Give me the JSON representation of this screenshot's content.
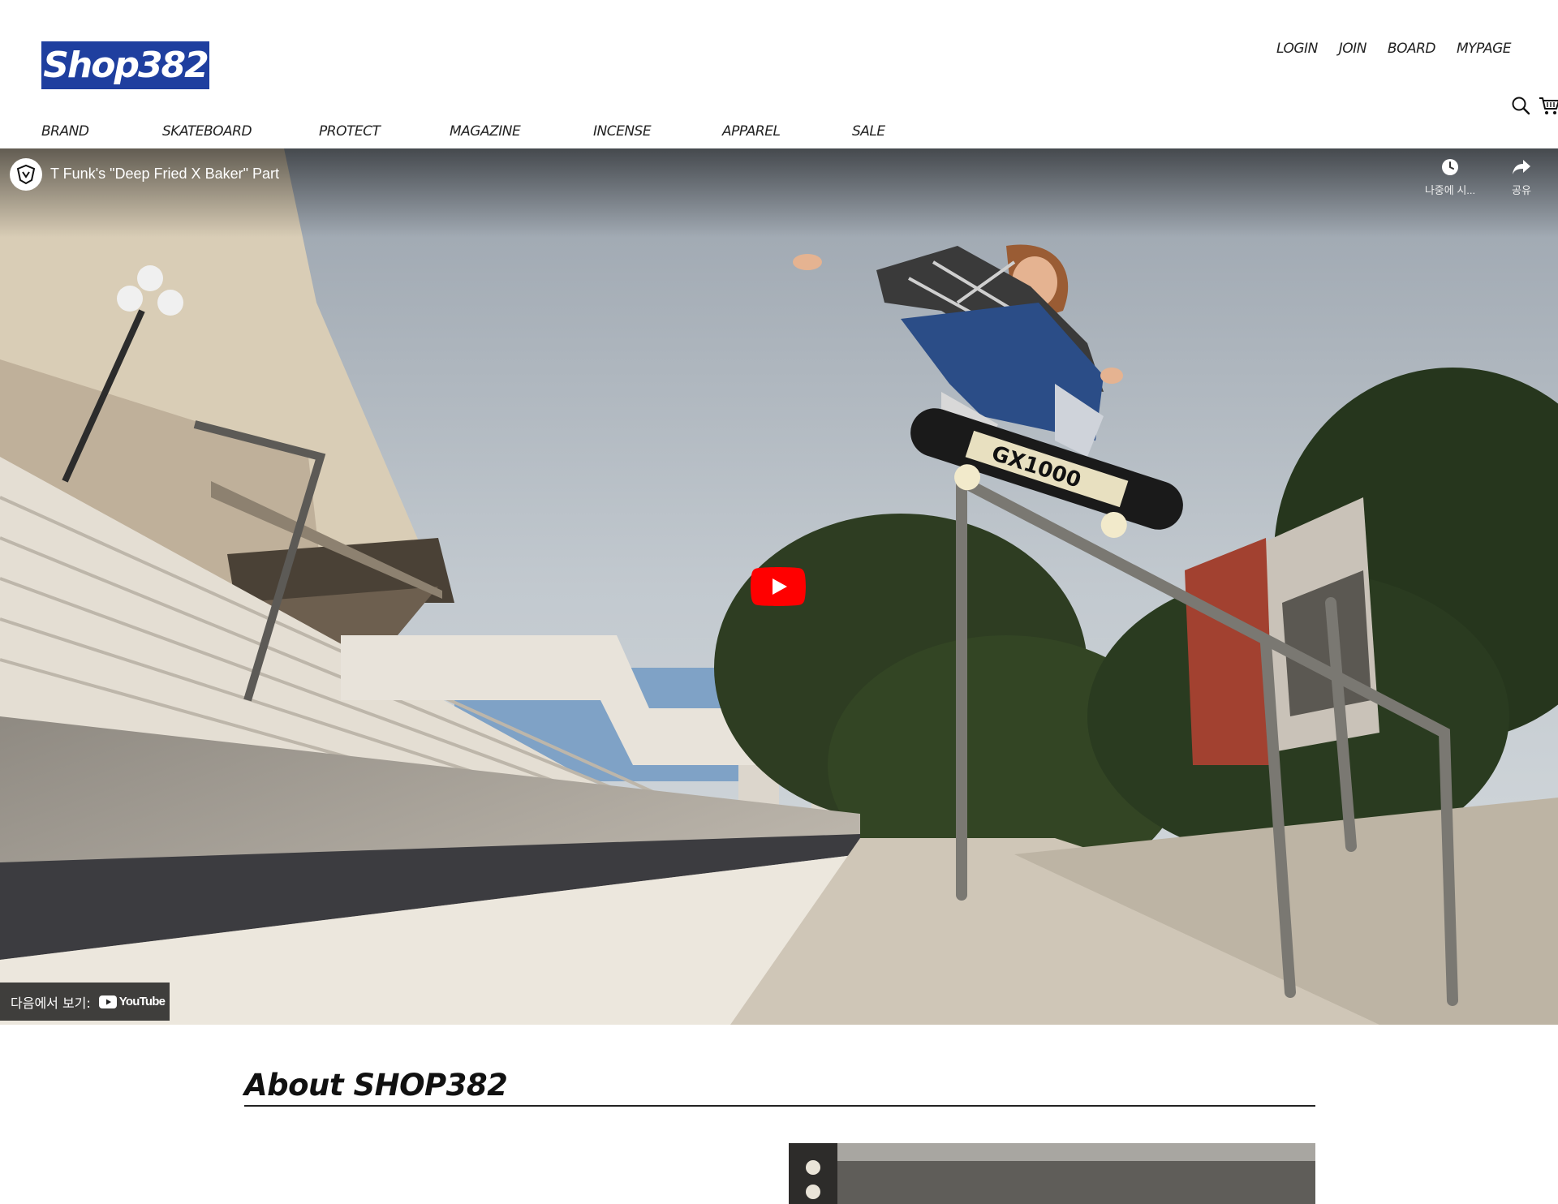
{
  "header": {
    "logo_text": "Shop382",
    "util_nav": [
      "LOGIN",
      "JOIN",
      "BOARD",
      "MYPAGE"
    ],
    "main_nav": [
      "BRAND",
      "SKATEBOARD",
      "PROTECT",
      "MAGAZINE",
      "INCENSE",
      "APPAREL",
      "SALE"
    ],
    "icons": [
      "search-icon",
      "cart-icon"
    ]
  },
  "video": {
    "title": "T Funk's \"Deep Fried X Baker\" Part",
    "watch_later_label": "나중에 시...",
    "share_label": "공유",
    "watch_on_label": "다음에서 보기:",
    "youtube_label": "YouTube"
  },
  "about": {
    "title": "About SHOP382"
  },
  "colors": {
    "logo_bg": "#1f3f9f",
    "youtube_red": "#ff0000"
  }
}
